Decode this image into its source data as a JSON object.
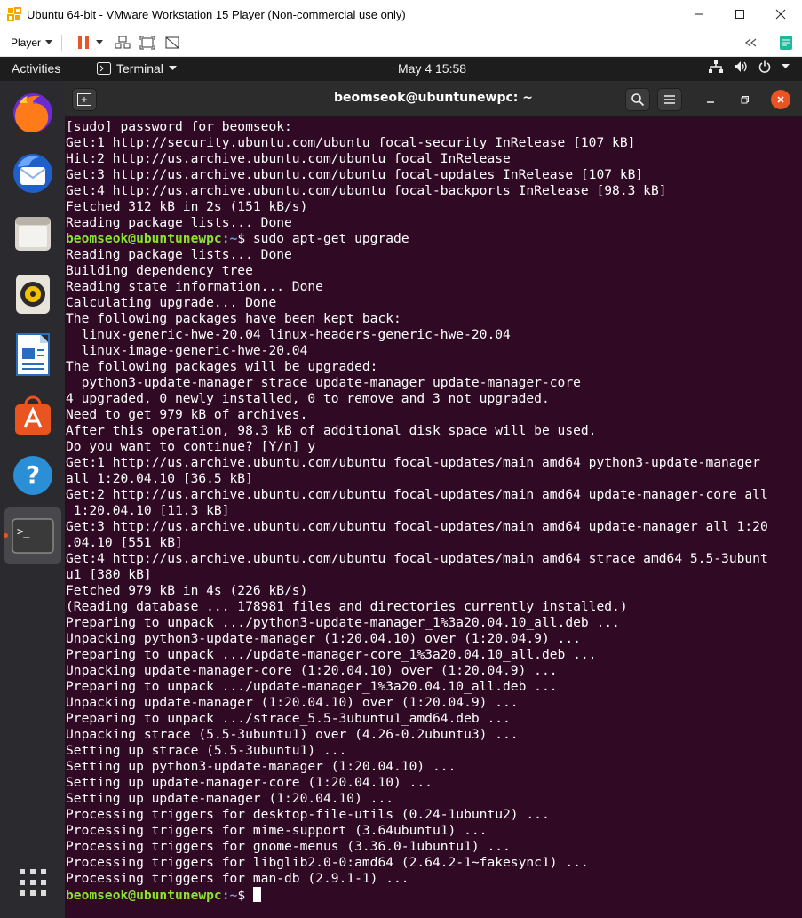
{
  "vmware": {
    "window_title": "Ubuntu 64-bit - VMware Workstation 15 Player (Non-commercial use only)",
    "player_menu_label": "Player"
  },
  "ubuntu_top_bar": {
    "activities_label": "Activities",
    "app_menu_label": "Terminal",
    "clock": "May 4  15:58"
  },
  "dock": {
    "items": [
      "Firefox",
      "Thunderbird",
      "Files",
      "Rhythmbox",
      "LibreOffice Writer",
      "Ubuntu Software",
      "Help",
      "Terminal"
    ],
    "active_item": "Terminal"
  },
  "terminal": {
    "title": "beomseok@ubuntunewpc: ~",
    "prompt_user": "beomseok@ubuntunewpc",
    "prompt_path": ":~",
    "prompt_symbol": "$ ",
    "lines": [
      {
        "type": "out",
        "text": "[sudo] password for beomseok:"
      },
      {
        "type": "out",
        "text": "Get:1 http://security.ubuntu.com/ubuntu focal-security InRelease [107 kB]"
      },
      {
        "type": "out",
        "text": "Hit:2 http://us.archive.ubuntu.com/ubuntu focal InRelease"
      },
      {
        "type": "out",
        "text": "Get:3 http://us.archive.ubuntu.com/ubuntu focal-updates InRelease [107 kB]"
      },
      {
        "type": "out",
        "text": "Get:4 http://us.archive.ubuntu.com/ubuntu focal-backports InRelease [98.3 kB]"
      },
      {
        "type": "out",
        "text": "Fetched 312 kB in 2s (151 kB/s)"
      },
      {
        "type": "out",
        "text": "Reading package lists... Done"
      },
      {
        "type": "prompt",
        "text": "sudo apt-get upgrade"
      },
      {
        "type": "out",
        "text": "Reading package lists... Done"
      },
      {
        "type": "out",
        "text": "Building dependency tree"
      },
      {
        "type": "out",
        "text": "Reading state information... Done"
      },
      {
        "type": "out",
        "text": "Calculating upgrade... Done"
      },
      {
        "type": "out",
        "text": "The following packages have been kept back:"
      },
      {
        "type": "out",
        "text": "  linux-generic-hwe-20.04 linux-headers-generic-hwe-20.04"
      },
      {
        "type": "out",
        "text": "  linux-image-generic-hwe-20.04"
      },
      {
        "type": "out",
        "text": "The following packages will be upgraded:"
      },
      {
        "type": "out",
        "text": "  python3-update-manager strace update-manager update-manager-core"
      },
      {
        "type": "out",
        "text": "4 upgraded, 0 newly installed, 0 to remove and 3 not upgraded."
      },
      {
        "type": "out",
        "text": "Need to get 979 kB of archives."
      },
      {
        "type": "out",
        "text": "After this operation, 98.3 kB of additional disk space will be used."
      },
      {
        "type": "out",
        "text": "Do you want to continue? [Y/n] y"
      },
      {
        "type": "out",
        "text": "Get:1 http://us.archive.ubuntu.com/ubuntu focal-updates/main amd64 python3-update-manager"
      },
      {
        "type": "out",
        "text": "all 1:20.04.10 [36.5 kB]"
      },
      {
        "type": "out",
        "text": "Get:2 http://us.archive.ubuntu.com/ubuntu focal-updates/main amd64 update-manager-core all"
      },
      {
        "type": "out",
        "text": " 1:20.04.10 [11.3 kB]"
      },
      {
        "type": "out",
        "text": "Get:3 http://us.archive.ubuntu.com/ubuntu focal-updates/main amd64 update-manager all 1:20"
      },
      {
        "type": "out",
        "text": ".04.10 [551 kB]"
      },
      {
        "type": "out",
        "text": "Get:4 http://us.archive.ubuntu.com/ubuntu focal-updates/main amd64 strace amd64 5.5-3ubunt"
      },
      {
        "type": "out",
        "text": "u1 [380 kB]"
      },
      {
        "type": "out",
        "text": "Fetched 979 kB in 4s (226 kB/s)"
      },
      {
        "type": "out",
        "text": "(Reading database ... 178981 files and directories currently installed.)"
      },
      {
        "type": "out",
        "text": "Preparing to unpack .../python3-update-manager_1%3a20.04.10_all.deb ..."
      },
      {
        "type": "out",
        "text": "Unpacking python3-update-manager (1:20.04.10) over (1:20.04.9) ..."
      },
      {
        "type": "out",
        "text": "Preparing to unpack .../update-manager-core_1%3a20.04.10_all.deb ..."
      },
      {
        "type": "out",
        "text": "Unpacking update-manager-core (1:20.04.10) over (1:20.04.9) ..."
      },
      {
        "type": "out",
        "text": "Preparing to unpack .../update-manager_1%3a20.04.10_all.deb ..."
      },
      {
        "type": "out",
        "text": "Unpacking update-manager (1:20.04.10) over (1:20.04.9) ..."
      },
      {
        "type": "out",
        "text": "Preparing to unpack .../strace_5.5-3ubuntu1_amd64.deb ..."
      },
      {
        "type": "out",
        "text": "Unpacking strace (5.5-3ubuntu1) over (4.26-0.2ubuntu3) ..."
      },
      {
        "type": "out",
        "text": "Setting up strace (5.5-3ubuntu1) ..."
      },
      {
        "type": "out",
        "text": "Setting up python3-update-manager (1:20.04.10) ..."
      },
      {
        "type": "out",
        "text": "Setting up update-manager-core (1:20.04.10) ..."
      },
      {
        "type": "out",
        "text": "Setting up update-manager (1:20.04.10) ..."
      },
      {
        "type": "out",
        "text": "Processing triggers for desktop-file-utils (0.24-1ubuntu2) ..."
      },
      {
        "type": "out",
        "text": "Processing triggers for mime-support (3.64ubuntu1) ..."
      },
      {
        "type": "out",
        "text": "Processing triggers for gnome-menus (3.36.0-1ubuntu1) ..."
      },
      {
        "type": "out",
        "text": "Processing triggers for libglib2.0-0:amd64 (2.64.2-1~fakesync1) ..."
      },
      {
        "type": "out",
        "text": "Processing triggers for man-db (2.9.1-1) ..."
      },
      {
        "type": "prompt",
        "text": ""
      }
    ]
  },
  "colors": {
    "terminal_bg": "#300a24",
    "prompt_user": "#8ae234",
    "prompt_path": "#729fcf",
    "dock_bg": "#2b2a2f",
    "accent": "#e95420"
  }
}
